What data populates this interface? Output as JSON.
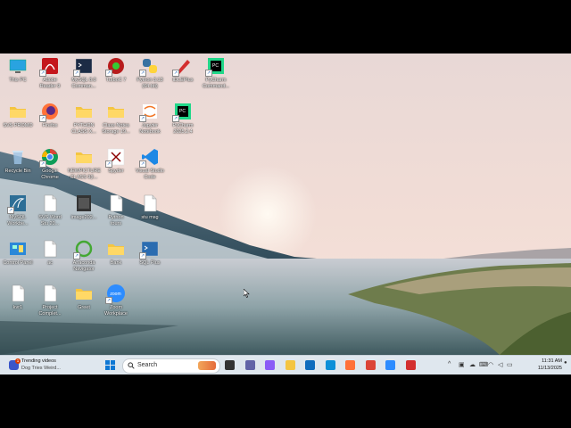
{
  "desktop_icons": [
    {
      "id": "this-pc",
      "label": "This PC",
      "icon": "monitor-icon",
      "color": "#29a3e0",
      "shortcut": false
    },
    {
      "id": "adobe-reader",
      "label": "Adobe\nReader 9",
      "icon": "pdf-icon",
      "color": "#c4161c",
      "shortcut": true
    },
    {
      "id": "mysql-cmd",
      "label": "MySQL 8.0\nComman...",
      "icon": "terminal-icon",
      "color": "#1c2b45",
      "shortcut": true
    },
    {
      "id": "turboc",
      "label": "TurboC 7",
      "icon": "turboc-icon",
      "color": "#b71c1c",
      "shortcut": true
    },
    {
      "id": "python",
      "label": "Python 3.13\n(64-bit)",
      "icon": "python-icon",
      "color": "#3771a1",
      "shortcut": true
    },
    {
      "id": "idle",
      "label": "IDLEPlus",
      "icon": "pencil-icon",
      "color": "#d32f2f",
      "shortcut": true
    },
    {
      "id": "pycharm-cmd",
      "label": "PyCharm\nCommand...",
      "icon": "pycharm-icon",
      "color": "#21d789",
      "shortcut": true
    },
    {
      "id": "svs-promo",
      "label": "SVS PROMO",
      "icon": "folder-icon",
      "color": "#f4c542",
      "shortcut": false
    },
    {
      "id": "firefox",
      "label": "Firefox",
      "icon": "firefox-icon",
      "color": "#ff7139",
      "shortcut": true
    },
    {
      "id": "python-class",
      "label": "PYTHON\nCLASS X...",
      "icon": "folder-icon",
      "color": "#f4c542",
      "shortcut": false
    },
    {
      "id": "class-notes",
      "label": "Class Notes\nStorage 19...",
      "icon": "folder-icon",
      "color": "#f4c542",
      "shortcut": false
    },
    {
      "id": "jupyter",
      "label": "Jupyter\nNotebook",
      "icon": "jupyter-icon",
      "color": "#f37626",
      "shortcut": true
    },
    {
      "id": "pycharm",
      "label": "PyCharm\n2025.2.4",
      "icon": "pycharm-icon",
      "color": "#21d789",
      "shortcut": true
    },
    {
      "id": "recycle",
      "label": "Recycle Bin",
      "icon": "recycle-bin-icon",
      "color": "#9ec6e8",
      "shortcut": false
    },
    {
      "id": "chrome",
      "label": "Google\nChrome",
      "icon": "chrome-icon",
      "color": "#db4437",
      "shortcut": true
    },
    {
      "id": "newpicture",
      "label": "NEWPICTURE\nCLASS 9(I...",
      "icon": "folder-icon",
      "color": "#f4c542",
      "shortcut": false
    },
    {
      "id": "spyder",
      "label": "Spyder",
      "icon": "spyder-icon",
      "color": "#8c0000",
      "shortcut": true
    },
    {
      "id": "vscode",
      "label": "Visual Studio\nCode",
      "icon": "vscode-icon",
      "color": "#1e88e5",
      "shortcut": true
    },
    {
      "id": "mysql-wb",
      "label": "MySQL\nWorkbe...",
      "icon": "dolphin-icon",
      "color": "#2d6e96",
      "shortcut": true
    },
    {
      "id": "svs-word",
      "label": "SVS Word\nStu 20...",
      "icon": "document-icon",
      "color": "#ffffff",
      "shortcut": false
    },
    {
      "id": "image2025",
      "label": "image202...",
      "icon": "image-icon",
      "color": "#555555",
      "shortcut": false
    },
    {
      "id": "python-tours",
      "label": "Python\ntours",
      "icon": "document-icon",
      "color": "#ffffff",
      "shortcut": false
    },
    {
      "id": "stu-msg",
      "label": "stu msg",
      "icon": "document-icon",
      "color": "#ffffff",
      "shortcut": false
    },
    {
      "id": "control-panel",
      "label": "Control Panel",
      "icon": "control-panel-icon",
      "color": "#2b88d8",
      "shortcut": false
    },
    {
      "id": "ac",
      "label": "ac",
      "icon": "document-icon",
      "color": "#ffffff",
      "shortcut": false
    },
    {
      "id": "anaconda",
      "label": "Anaconda\nNavigator",
      "icon": "anaconda-icon",
      "color": "#44a833",
      "shortcut": true
    },
    {
      "id": "bank",
      "label": "Bank",
      "icon": "folder-icon",
      "color": "#f4c542",
      "shortcut": false
    },
    {
      "id": "sqlplus",
      "label": "SQL Plus",
      "icon": "sqlplus-icon",
      "color": "#2b6cb0",
      "shortcut": true
    },
    {
      "id": "kvr1",
      "label": "kvr1",
      "icon": "document-icon",
      "color": "#ffffff",
      "shortcut": false
    },
    {
      "id": "project",
      "label": "Project\nComplet...",
      "icon": "document-icon",
      "color": "#ffffff",
      "shortcut": false
    },
    {
      "id": "greet",
      "label": "Greet",
      "icon": "folder-icon",
      "color": "#f4c542",
      "shortcut": false
    },
    {
      "id": "zoom",
      "label": "Zoom\nWorkplace",
      "icon": "zoom-icon",
      "color": "#2d8cff",
      "shortcut": true
    }
  ],
  "taskbar": {
    "widget_title": "Trending videos",
    "widget_subtitle": "Dog Tries Weird...",
    "widget_badge": "1",
    "search_placeholder": "Search",
    "apps": [
      {
        "name": "task-view-icon",
        "color": "#333333"
      },
      {
        "name": "teams-icon",
        "color": "#6264a7"
      },
      {
        "name": "copilot-icon",
        "color": "#8a5cf6"
      },
      {
        "name": "file-explorer-icon",
        "color": "#f4c542"
      },
      {
        "name": "store-icon",
        "color": "#0f6cbd"
      },
      {
        "name": "edge-icon",
        "color": "#0c8fd8"
      },
      {
        "name": "firefox-icon",
        "color": "#ff7139"
      },
      {
        "name": "chrome-icon",
        "color": "#db4437"
      },
      {
        "name": "zoom-icon",
        "color": "#2d8cff"
      },
      {
        "name": "idle-icon",
        "color": "#d32f2f"
      }
    ],
    "time": "11:31 AM",
    "date": "11/13/2025"
  }
}
